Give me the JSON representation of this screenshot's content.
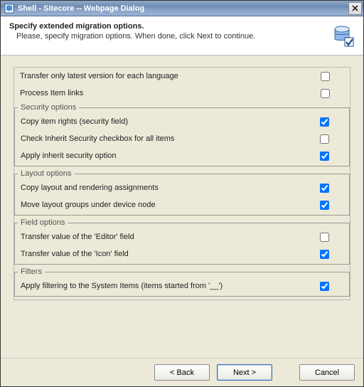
{
  "titlebar": {
    "title": "Shell - Sitecore -- Webpage Dialog",
    "close": "×"
  },
  "header": {
    "title": "Specify extended migration options.",
    "description": "Please, specify migration options. When done, click Next to continue."
  },
  "rows": {
    "latest_version": {
      "label": "Transfer only latest version for each language",
      "checked": false
    },
    "process_links": {
      "label": "Process Item links",
      "checked": false
    }
  },
  "groups": {
    "security": {
      "legend": "Security options",
      "rows": {
        "copy_rights": {
          "label": "Copy item rights (security field)",
          "checked": true
        },
        "inherit_cb": {
          "label": "Check Inherit Security checkbox for all items",
          "checked": false
        },
        "apply_inherit": {
          "label": "Apply inherit security option",
          "checked": true
        }
      }
    },
    "layout": {
      "legend": "Layout options",
      "rows": {
        "copy_layout": {
          "label": "Copy layout and rendering assignments",
          "checked": true
        },
        "move_groups": {
          "label": "Move layout groups under device node",
          "checked": true
        }
      }
    },
    "field": {
      "legend": "Field options",
      "rows": {
        "editor": {
          "label": "Transfer value of the 'Editor' field",
          "checked": false
        },
        "icon": {
          "label": "Transfer value of the 'Icon' field",
          "checked": true
        }
      }
    },
    "filters": {
      "legend": "Filters",
      "rows": {
        "system_items": {
          "label": "Apply filtering to the System Items (items started from '__')",
          "checked": true
        }
      }
    }
  },
  "buttons": {
    "back": "< Back",
    "next": "Next >",
    "cancel": "Cancel"
  }
}
